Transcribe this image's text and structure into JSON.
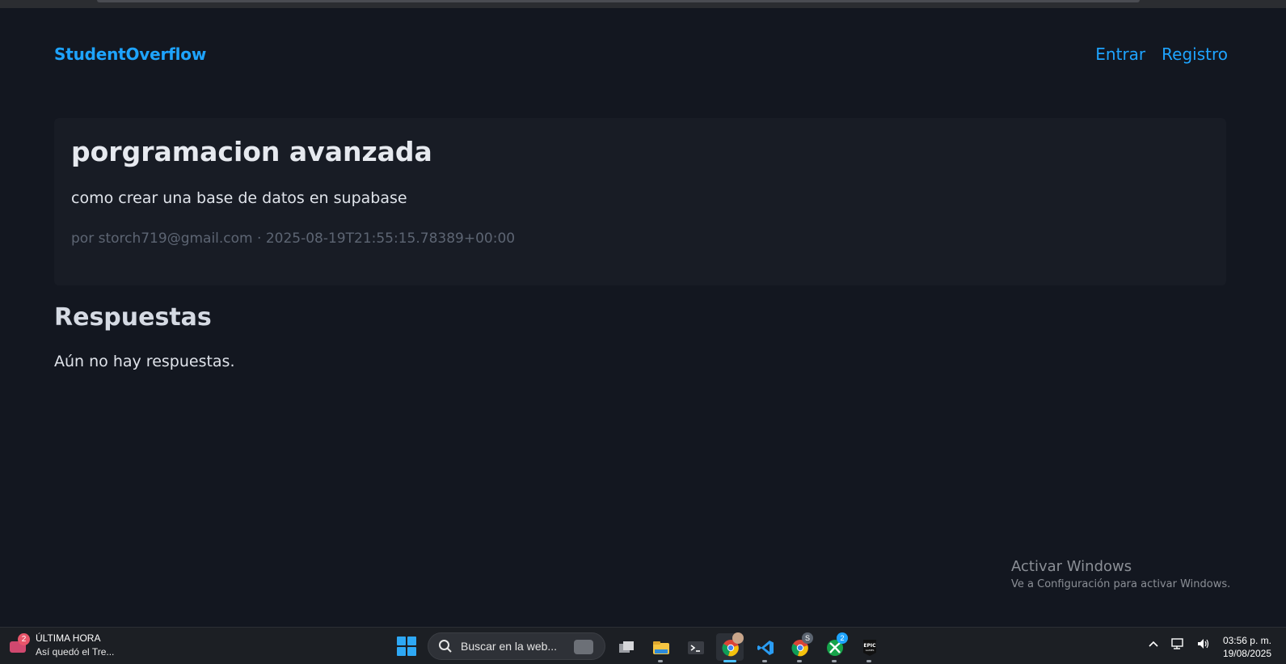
{
  "header": {
    "brand": "StudentOverflow",
    "nav": {
      "login": "Entrar",
      "register": "Registro"
    }
  },
  "question": {
    "title": "porgramacion avanzada",
    "body": "como crear una base de datos en supabase",
    "meta": "por storch719@gmail.com · 2025-08-19T21:55:15.78389+00:00"
  },
  "answers": {
    "heading": "Respuestas",
    "empty_message": "Aún no hay respuestas."
  },
  "watermark": {
    "line1": "Activar Windows",
    "line2": "Ve a Configuración para activar Windows."
  },
  "taskbar": {
    "news": {
      "badge": "2",
      "headline": "ÚLTIMA HORA",
      "subline": "Así quedó el Tre..."
    },
    "search_placeholder": "Buscar en la web...",
    "apps": [
      {
        "name": "task-view"
      },
      {
        "name": "file-explorer"
      },
      {
        "name": "terminal"
      },
      {
        "name": "chrome",
        "active": true
      },
      {
        "name": "vscode"
      },
      {
        "name": "chrome-profile",
        "badge": "S"
      },
      {
        "name": "xbox",
        "badge": "2"
      },
      {
        "name": "epic-games"
      }
    ],
    "clock": {
      "time": "03:56 p. m.",
      "date": "19/08/2025"
    }
  },
  "colors": {
    "background": "#131720",
    "card": "#181c25",
    "accent": "#1ea4ff"
  }
}
